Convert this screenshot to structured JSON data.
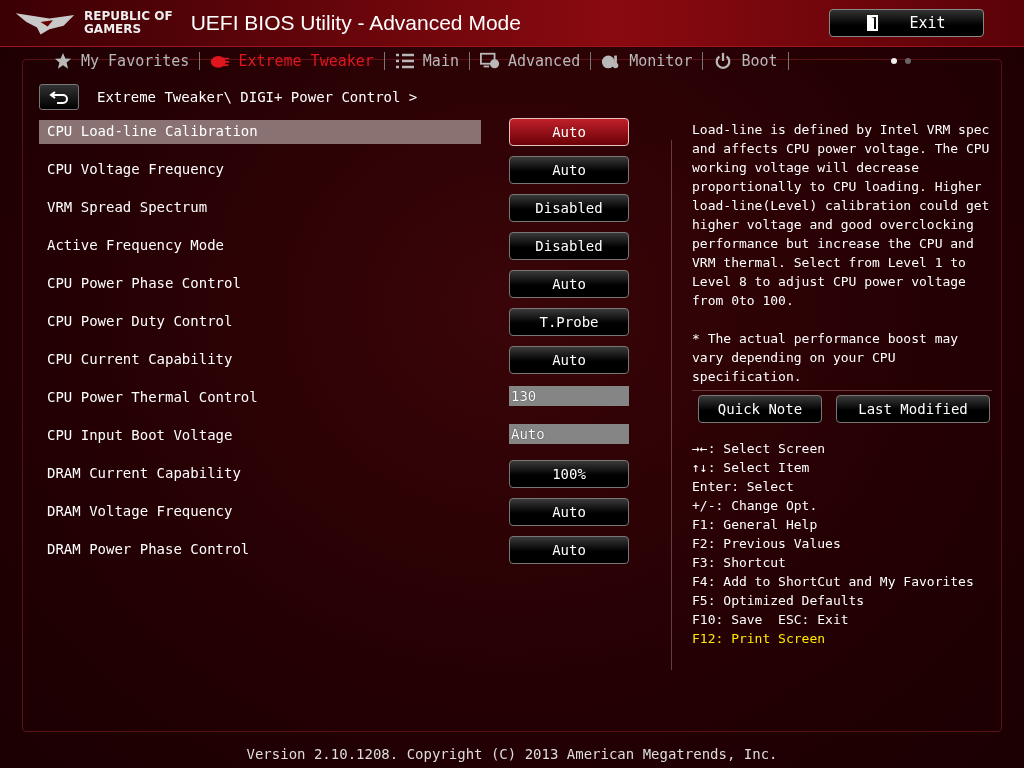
{
  "header": {
    "brand_line_1": "REPUBLIC OF",
    "brand_line_2": "GAMERS",
    "title": "UEFI BIOS Utility - Advanced Mode",
    "exit_label": "Exit"
  },
  "tabs": [
    {
      "label": "My Favorites",
      "kind": "star",
      "selected": false
    },
    {
      "label": "Extreme Tweaker",
      "kind": "tweaker",
      "selected": true
    },
    {
      "label": "Main",
      "kind": "list",
      "selected": false
    },
    {
      "label": "Advanced",
      "kind": "advanced",
      "selected": false
    },
    {
      "label": "Monitor",
      "kind": "monitor",
      "selected": false
    },
    {
      "label": "Boot",
      "kind": "power",
      "selected": false
    }
  ],
  "page_dots": [
    {
      "selected": true
    },
    {
      "selected": false
    }
  ],
  "breadcrumb": "Extreme Tweaker\\ DIGI+ Power Control >",
  "settings": [
    {
      "name": "CPU Load-line Calibration",
      "value": "Auto",
      "kind": "button",
      "selected": true
    },
    {
      "name": "CPU Voltage Frequency",
      "value": "Auto",
      "kind": "button",
      "selected": false
    },
    {
      "name": "VRM Spread Spectrum",
      "value": "Disabled",
      "kind": "button",
      "selected": false
    },
    {
      "name": "Active Frequency Mode",
      "value": "Disabled",
      "kind": "button",
      "selected": false
    },
    {
      "name": "CPU Power Phase Control",
      "value": "Auto",
      "kind": "button",
      "selected": false
    },
    {
      "name": "CPU Power Duty Control",
      "value": "T.Probe",
      "kind": "button",
      "selected": false
    },
    {
      "name": "CPU Current Capability",
      "value": "Auto",
      "kind": "button",
      "selected": false
    },
    {
      "name": "CPU Power Thermal Control",
      "value": "130",
      "kind": "input",
      "selected": false
    },
    {
      "name": "CPU Input Boot Voltage",
      "value": "Auto",
      "kind": "input",
      "selected": false
    },
    {
      "name": "DRAM Current Capability",
      "value": "100%",
      "kind": "button",
      "selected": false
    },
    {
      "name": "DRAM Voltage Frequency",
      "value": "Auto",
      "kind": "button",
      "selected": false
    },
    {
      "name": "DRAM Power Phase Control",
      "value": "Auto",
      "kind": "button",
      "selected": false
    }
  ],
  "help_text": [
    "Load-line is defined by Intel VRM spec and affects CPU power voltage. The CPU working voltage will decrease proportionally to CPU loading. Higher load-line(Level) calibration could get higher voltage and good overclocking performance but increase the CPU and VRM thermal. Select from Level 1 to Level 8 to adjust CPU power voltage from 0to 100.",
    "* The actual performance boost may vary depending on your CPU specification."
  ],
  "help_buttons": [
    "Quick Note",
    "Last Modified"
  ],
  "key_hints": [
    {
      "text": "→←: Select Screen",
      "highlight": false
    },
    {
      "text": "↑↓: Select Item",
      "highlight": false
    },
    {
      "text": "Enter: Select",
      "highlight": false
    },
    {
      "text": "+/-: Change Opt.",
      "highlight": false
    },
    {
      "text": "F1: General Help",
      "highlight": false
    },
    {
      "text": "F2: Previous Values",
      "highlight": false
    },
    {
      "text": "F3: Shortcut",
      "highlight": false
    },
    {
      "text": "F4: Add to ShortCut and My Favorites",
      "highlight": false
    },
    {
      "text": "F5: Optimized Defaults",
      "highlight": false
    },
    {
      "text": "F10: Save  ESC: Exit",
      "highlight": false
    },
    {
      "text": "F12: Print Screen",
      "highlight": true
    }
  ],
  "status_bar": "Version 2.10.1208. Copyright (C) 2013 American Megatrends, Inc."
}
